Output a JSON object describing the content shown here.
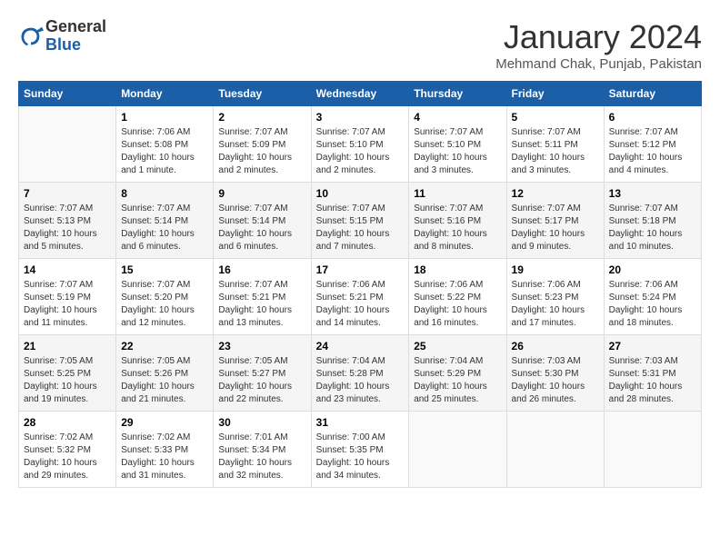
{
  "header": {
    "logo_line1": "General",
    "logo_line2": "Blue",
    "month_title": "January 2024",
    "subtitle": "Mehmand Chak, Punjab, Pakistan"
  },
  "weekdays": [
    "Sunday",
    "Monday",
    "Tuesday",
    "Wednesday",
    "Thursday",
    "Friday",
    "Saturday"
  ],
  "weeks": [
    [
      {
        "day": "",
        "info": ""
      },
      {
        "day": "1",
        "info": "Sunrise: 7:06 AM\nSunset: 5:08 PM\nDaylight: 10 hours\nand 1 minute."
      },
      {
        "day": "2",
        "info": "Sunrise: 7:07 AM\nSunset: 5:09 PM\nDaylight: 10 hours\nand 2 minutes."
      },
      {
        "day": "3",
        "info": "Sunrise: 7:07 AM\nSunset: 5:10 PM\nDaylight: 10 hours\nand 2 minutes."
      },
      {
        "day": "4",
        "info": "Sunrise: 7:07 AM\nSunset: 5:10 PM\nDaylight: 10 hours\nand 3 minutes."
      },
      {
        "day": "5",
        "info": "Sunrise: 7:07 AM\nSunset: 5:11 PM\nDaylight: 10 hours\nand 3 minutes."
      },
      {
        "day": "6",
        "info": "Sunrise: 7:07 AM\nSunset: 5:12 PM\nDaylight: 10 hours\nand 4 minutes."
      }
    ],
    [
      {
        "day": "7",
        "info": "Sunrise: 7:07 AM\nSunset: 5:13 PM\nDaylight: 10 hours\nand 5 minutes."
      },
      {
        "day": "8",
        "info": "Sunrise: 7:07 AM\nSunset: 5:14 PM\nDaylight: 10 hours\nand 6 minutes."
      },
      {
        "day": "9",
        "info": "Sunrise: 7:07 AM\nSunset: 5:14 PM\nDaylight: 10 hours\nand 6 minutes."
      },
      {
        "day": "10",
        "info": "Sunrise: 7:07 AM\nSunset: 5:15 PM\nDaylight: 10 hours\nand 7 minutes."
      },
      {
        "day": "11",
        "info": "Sunrise: 7:07 AM\nSunset: 5:16 PM\nDaylight: 10 hours\nand 8 minutes."
      },
      {
        "day": "12",
        "info": "Sunrise: 7:07 AM\nSunset: 5:17 PM\nDaylight: 10 hours\nand 9 minutes."
      },
      {
        "day": "13",
        "info": "Sunrise: 7:07 AM\nSunset: 5:18 PM\nDaylight: 10 hours\nand 10 minutes."
      }
    ],
    [
      {
        "day": "14",
        "info": "Sunrise: 7:07 AM\nSunset: 5:19 PM\nDaylight: 10 hours\nand 11 minutes."
      },
      {
        "day": "15",
        "info": "Sunrise: 7:07 AM\nSunset: 5:20 PM\nDaylight: 10 hours\nand 12 minutes."
      },
      {
        "day": "16",
        "info": "Sunrise: 7:07 AM\nSunset: 5:21 PM\nDaylight: 10 hours\nand 13 minutes."
      },
      {
        "day": "17",
        "info": "Sunrise: 7:06 AM\nSunset: 5:21 PM\nDaylight: 10 hours\nand 14 minutes."
      },
      {
        "day": "18",
        "info": "Sunrise: 7:06 AM\nSunset: 5:22 PM\nDaylight: 10 hours\nand 16 minutes."
      },
      {
        "day": "19",
        "info": "Sunrise: 7:06 AM\nSunset: 5:23 PM\nDaylight: 10 hours\nand 17 minutes."
      },
      {
        "day": "20",
        "info": "Sunrise: 7:06 AM\nSunset: 5:24 PM\nDaylight: 10 hours\nand 18 minutes."
      }
    ],
    [
      {
        "day": "21",
        "info": "Sunrise: 7:05 AM\nSunset: 5:25 PM\nDaylight: 10 hours\nand 19 minutes."
      },
      {
        "day": "22",
        "info": "Sunrise: 7:05 AM\nSunset: 5:26 PM\nDaylight: 10 hours\nand 21 minutes."
      },
      {
        "day": "23",
        "info": "Sunrise: 7:05 AM\nSunset: 5:27 PM\nDaylight: 10 hours\nand 22 minutes."
      },
      {
        "day": "24",
        "info": "Sunrise: 7:04 AM\nSunset: 5:28 PM\nDaylight: 10 hours\nand 23 minutes."
      },
      {
        "day": "25",
        "info": "Sunrise: 7:04 AM\nSunset: 5:29 PM\nDaylight: 10 hours\nand 25 minutes."
      },
      {
        "day": "26",
        "info": "Sunrise: 7:03 AM\nSunset: 5:30 PM\nDaylight: 10 hours\nand 26 minutes."
      },
      {
        "day": "27",
        "info": "Sunrise: 7:03 AM\nSunset: 5:31 PM\nDaylight: 10 hours\nand 28 minutes."
      }
    ],
    [
      {
        "day": "28",
        "info": "Sunrise: 7:02 AM\nSunset: 5:32 PM\nDaylight: 10 hours\nand 29 minutes."
      },
      {
        "day": "29",
        "info": "Sunrise: 7:02 AM\nSunset: 5:33 PM\nDaylight: 10 hours\nand 31 minutes."
      },
      {
        "day": "30",
        "info": "Sunrise: 7:01 AM\nSunset: 5:34 PM\nDaylight: 10 hours\nand 32 minutes."
      },
      {
        "day": "31",
        "info": "Sunrise: 7:00 AM\nSunset: 5:35 PM\nDaylight: 10 hours\nand 34 minutes."
      },
      {
        "day": "",
        "info": ""
      },
      {
        "day": "",
        "info": ""
      },
      {
        "day": "",
        "info": ""
      }
    ]
  ]
}
